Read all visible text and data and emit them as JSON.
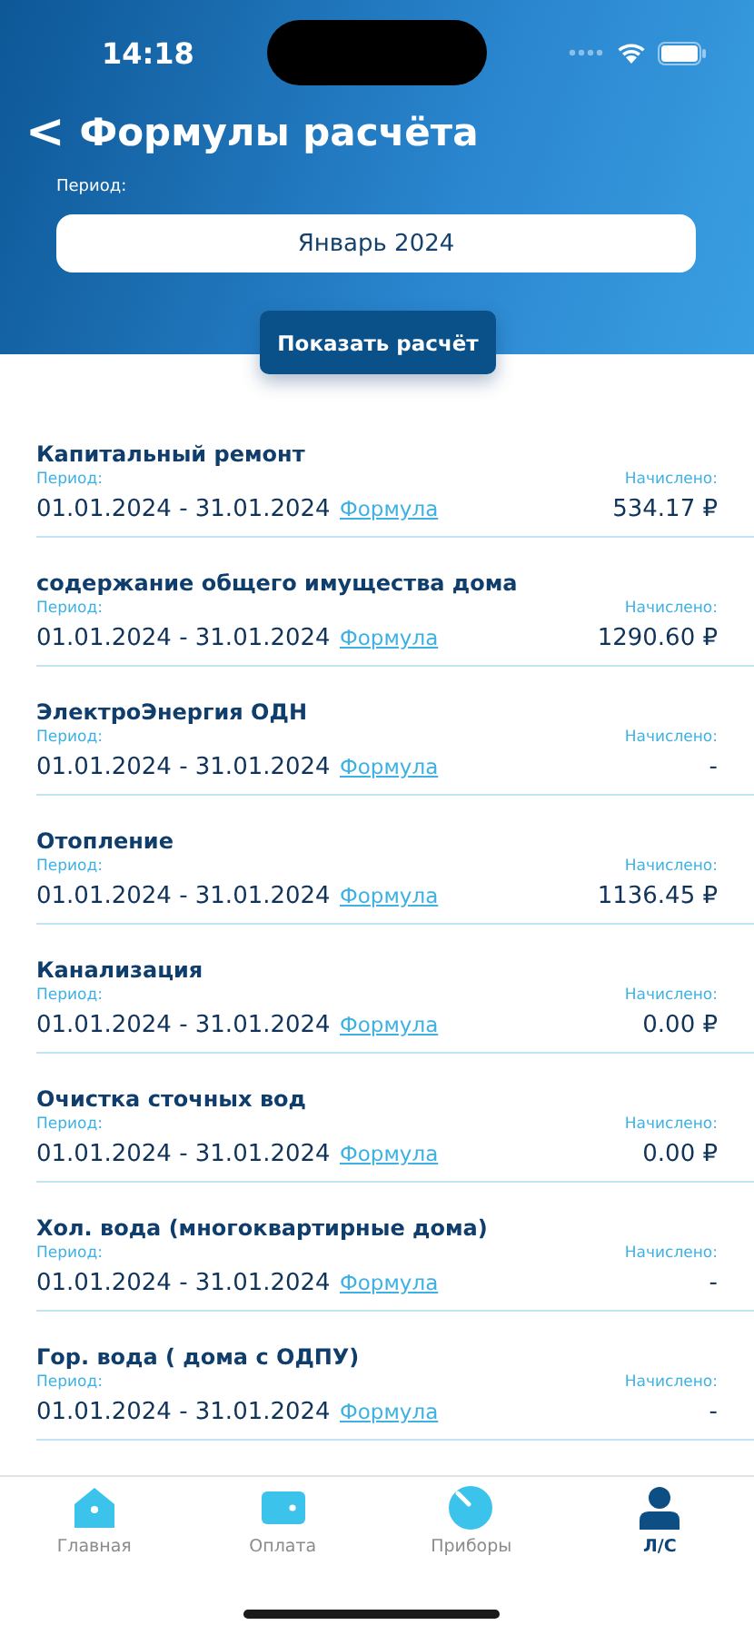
{
  "status_bar": {
    "time": "14:18"
  },
  "header": {
    "back": "<",
    "title": "Формулы расчёта",
    "period_label": "Период:",
    "period_value": "Январь 2024",
    "button": "Показать расчёт"
  },
  "items": [
    {
      "title": "Капитальный ремонт",
      "period_label": "Период:",
      "period": "01.01.2024 - 31.01.2024",
      "link": "Формула",
      "amount_label": "Начислено:",
      "amount": "534.17 ₽"
    },
    {
      "title": "содержание общего имущества дома",
      "period_label": "Период:",
      "period": "01.01.2024 - 31.01.2024",
      "link": "Формула",
      "amount_label": "Начислено:",
      "amount": "1290.60 ₽"
    },
    {
      "title": "ЭлектроЭнергия ОДН",
      "period_label": "Период:",
      "period": "01.01.2024 - 31.01.2024",
      "link": "Формула",
      "amount_label": "Начислено:",
      "amount": "-"
    },
    {
      "title": "Отопление",
      "period_label": "Период:",
      "period": "01.01.2024 - 31.01.2024",
      "link": "Формула",
      "amount_label": "Начислено:",
      "amount": "1136.45 ₽"
    },
    {
      "title": "Канализация",
      "period_label": "Период:",
      "period": "01.01.2024 - 31.01.2024",
      "link": "Формула",
      "amount_label": "Начислено:",
      "amount": "0.00 ₽"
    },
    {
      "title": "Очистка сточных вод",
      "period_label": "Период:",
      "period": "01.01.2024 - 31.01.2024",
      "link": "Формула",
      "amount_label": "Начислено:",
      "amount": "0.00 ₽"
    },
    {
      "title": "Хол. вода (многоквартирные дома)",
      "period_label": "Период:",
      "period": "01.01.2024 - 31.01.2024",
      "link": "Формула",
      "amount_label": "Начислено:",
      "amount": "-"
    },
    {
      "title": "Гор. вода ( дома с ОДПУ)",
      "period_label": "Период:",
      "period": "01.01.2024 - 31.01.2024",
      "link": "Формула",
      "amount_label": "Начислено:",
      "amount": "-"
    }
  ],
  "tabs": [
    {
      "kind": "home",
      "label": "Главная",
      "selected": false
    },
    {
      "kind": "wallet",
      "label": "Оплата",
      "selected": false
    },
    {
      "kind": "meter",
      "label": "Приборы",
      "selected": false
    },
    {
      "kind": "user",
      "label": "Л/С",
      "selected": true
    }
  ]
}
